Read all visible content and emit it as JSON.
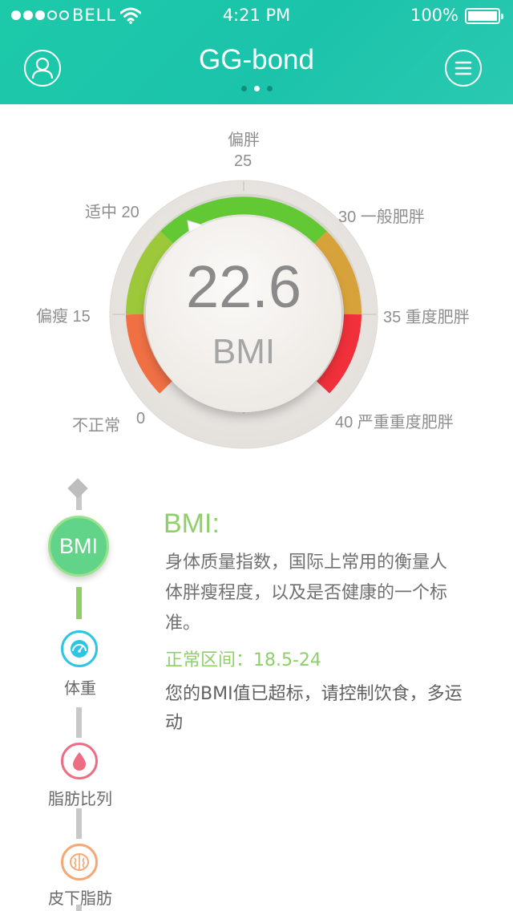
{
  "status_bar": {
    "carrier": "BELL",
    "time": "4:21 PM",
    "battery": "100%"
  },
  "header": {
    "title": "GG-bond",
    "page_count": 3,
    "active_page": 2,
    "left_icon": "profile-icon",
    "right_icon": "menu-icon",
    "bg_color": "#1cc8aa"
  },
  "gauge": {
    "value": "22.6",
    "unit": "BMI",
    "value_numeric": 22.6,
    "scale_min": 0,
    "scale_max": 40,
    "labels": {
      "l0": "不正常",
      "l0_num": "0",
      "l15": "偏瘦 15",
      "l20": "适中 20",
      "l25_text": "偏胖",
      "l25_num": "25",
      "l30": "30 一般肥胖",
      "l35": "35 重度肥胖",
      "l40": "40 严重重度肥胖"
    },
    "colors": {
      "green": "#5ec832",
      "yellow": "#c9b63a",
      "orange": "#f06a3a",
      "red": "#f0263a"
    }
  },
  "nav": {
    "active": "BMI",
    "items": [
      {
        "label": "体重",
        "icon": "speedometer-icon",
        "color": "#2cc5e3"
      },
      {
        "label": "脂肪比列",
        "icon": "drop-icon",
        "color": "#ef6d82"
      },
      {
        "label": "皮下脂肪",
        "icon": "brain-icon",
        "color": "#f5a874"
      }
    ]
  },
  "info": {
    "title": "BMI:",
    "description": "身体质量指数，国际上常用的衡量人体胖瘦程度，以及是否健康的一个标准。",
    "range": "正常区间：18.5-24",
    "advice": "您的BMI值已超标，请控制饮食，多运动"
  }
}
